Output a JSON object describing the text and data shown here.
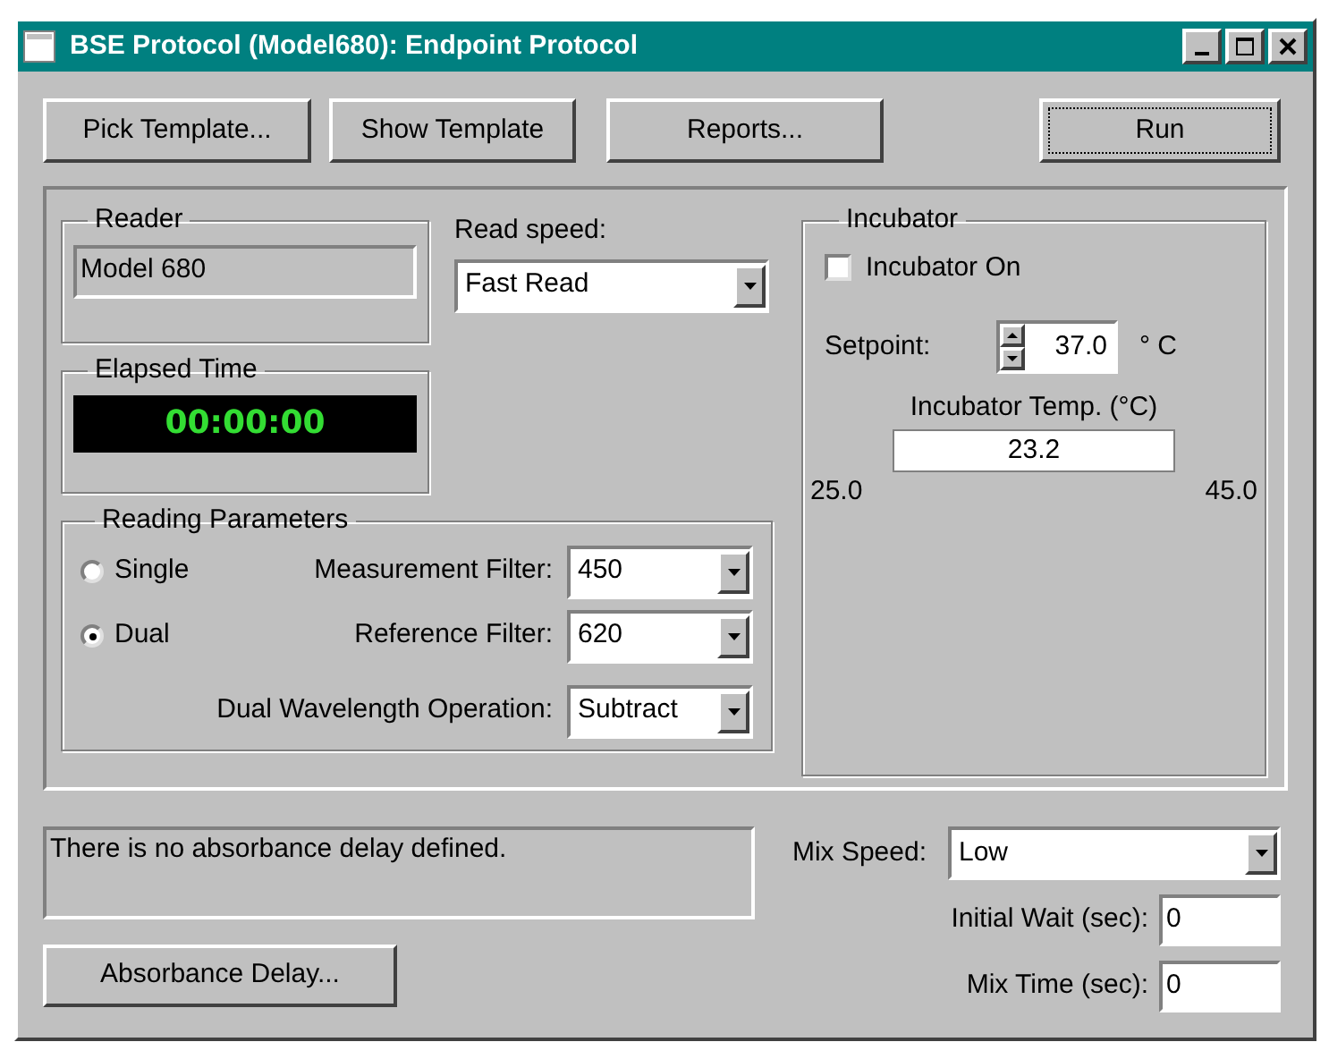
{
  "window": {
    "title": "BSE Protocol (Model680): Endpoint Protocol"
  },
  "toolbar": {
    "buttons": [
      {
        "label": "Pick Template...",
        "focused": false
      },
      {
        "label": "Show Template",
        "focused": false
      },
      {
        "label": "Reports...",
        "focused": false
      },
      {
        "label": "Run",
        "focused": true
      }
    ]
  },
  "reader": {
    "title": "Reader",
    "value": "Model 680"
  },
  "read_speed": {
    "label": "Read speed:",
    "value": "Fast Read"
  },
  "elapsed_time": {
    "title": "Elapsed Time",
    "value": "00:00:00"
  },
  "reading_parameters": {
    "title": "Reading Parameters",
    "modes": [
      {
        "label": "Single",
        "selected": false
      },
      {
        "label": "Dual",
        "selected": true
      }
    ],
    "filters": [
      {
        "label": "Measurement Filter:",
        "value": "450"
      },
      {
        "label": "Reference Filter:",
        "value": "620"
      },
      {
        "label": "Dual Wavelength Operation:",
        "value": "Subtract"
      }
    ]
  },
  "incubator": {
    "title": "Incubator",
    "toggle": {
      "label": "Incubator On",
      "checked": false
    },
    "setpoint": {
      "label": "Setpoint:",
      "value": "37.0",
      "unit": "° C"
    },
    "temperature": {
      "label": "Incubator Temp. (°C)",
      "value": "23.2",
      "min": "25.0",
      "max": "45.0"
    }
  },
  "absorbance": {
    "message": "There is no absorbance delay defined.",
    "button": "Absorbance Delay..."
  },
  "mix": {
    "speed": {
      "label": "Mix Speed:",
      "value": "Low"
    },
    "fields": [
      {
        "label": "Initial Wait (sec):",
        "value": "0"
      },
      {
        "label": "Mix Time (sec):",
        "value": "0"
      }
    ]
  }
}
